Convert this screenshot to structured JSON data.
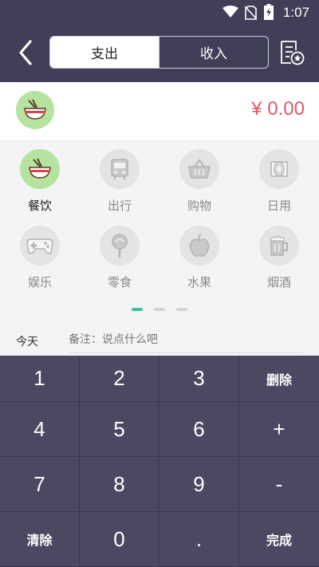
{
  "status_bar": {
    "time": "1:07"
  },
  "header": {
    "tabs": [
      {
        "label": "支出",
        "active": true
      },
      {
        "label": "收入",
        "active": false
      }
    ]
  },
  "amount": {
    "value": "¥ 0.00",
    "color": "#e2586a"
  },
  "categories": [
    {
      "label": "餐饮",
      "icon": "bowl-icon",
      "active": true
    },
    {
      "label": "出行",
      "icon": "bus-icon",
      "active": false
    },
    {
      "label": "购物",
      "icon": "basket-icon",
      "active": false
    },
    {
      "label": "日用",
      "icon": "tissue-icon",
      "active": false
    },
    {
      "label": "娱乐",
      "icon": "gamepad-icon",
      "active": false
    },
    {
      "label": "零食",
      "icon": "lollipop-icon",
      "active": false
    },
    {
      "label": "水果",
      "icon": "apple-icon",
      "active": false
    },
    {
      "label": "烟酒",
      "icon": "beer-icon",
      "active": false
    }
  ],
  "pager": {
    "pages": 3,
    "current": 1
  },
  "note_row": {
    "date": "今天",
    "placeholder": "备注：说点什么吧"
  },
  "keypad": {
    "keys": [
      "1",
      "2",
      "3",
      "删除",
      "4",
      "5",
      "6",
      "+",
      "7",
      "8",
      "9",
      "-",
      "清除",
      "0",
      ".",
      "完成"
    ]
  },
  "colors": {
    "header": "#413e58",
    "keypad": "#4b4862",
    "accent_green": "#b6e39f",
    "pager_active": "#3fc29a"
  }
}
